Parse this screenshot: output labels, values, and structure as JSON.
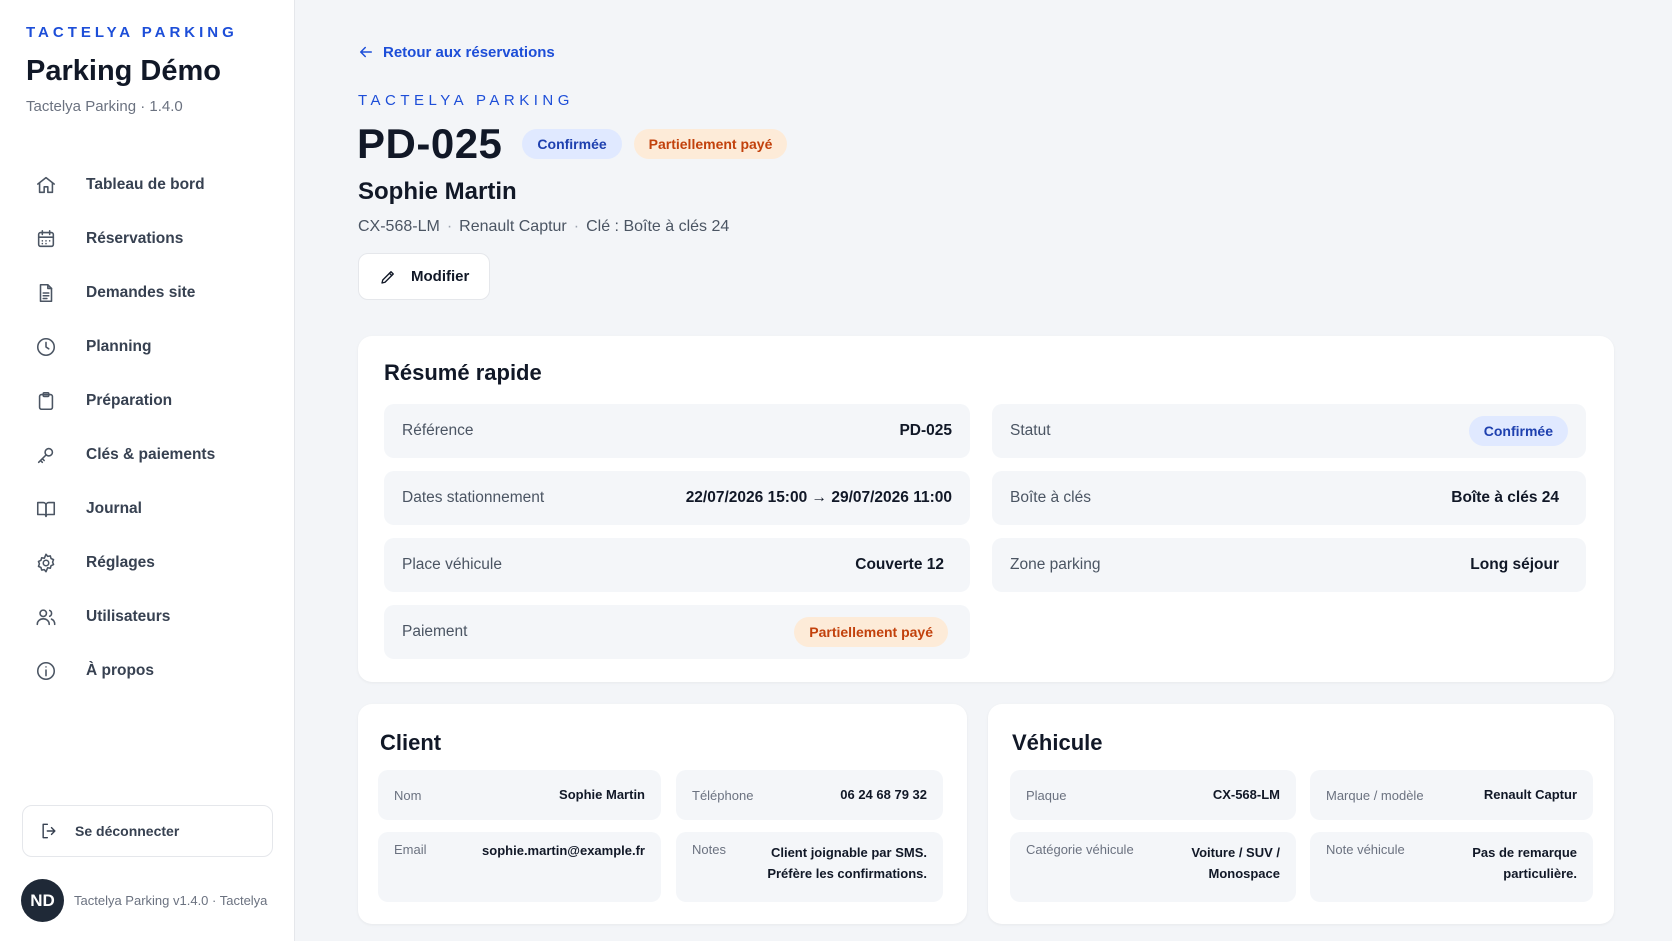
{
  "sidebar": {
    "eyebrow": "TACTELYA PARKING",
    "title": "Parking Démo",
    "subtitle": "Tactelya Parking · 1.4.0",
    "items": [
      {
        "label": "Tableau de bord",
        "icon": "home-icon"
      },
      {
        "label": "Réservations",
        "icon": "calendar-icon"
      },
      {
        "label": "Demandes site",
        "icon": "document-icon"
      },
      {
        "label": "Planning",
        "icon": "clock-icon"
      },
      {
        "label": "Préparation",
        "icon": "clipboard-icon"
      },
      {
        "label": "Clés & paiements",
        "icon": "key-icon"
      },
      {
        "label": "Journal",
        "icon": "book-icon"
      },
      {
        "label": "Réglages",
        "icon": "gear-icon"
      },
      {
        "label": "Utilisateurs",
        "icon": "users-icon"
      },
      {
        "label": "À propos",
        "icon": "info-icon"
      }
    ],
    "logout_label": "Se déconnecter",
    "avatar_initials": "ND",
    "footer_text": "Tactelya Parking v1.4.0 · Tactelya"
  },
  "header": {
    "back_label": "Retour aux réservations",
    "eyebrow": "TACTELYA PARKING",
    "reference": "PD-025",
    "status_badge": "Confirmée",
    "payment_badge": "Partiellement payé",
    "client_name": "Sophie Martin",
    "plate": "CX-568-LM",
    "model": "Renault Captur",
    "key_info": "Clé : Boîte à clés 24",
    "edit_label": "Modifier"
  },
  "summary": {
    "title": "Résumé rapide",
    "reference_label": "Référence",
    "reference_value": "PD-025",
    "status_label": "Statut",
    "status_value": "Confirmée",
    "dates_label": "Dates stationnement",
    "dates_value": "22/07/2026 15:00 → 29/07/2026 11:00",
    "keybox_label": "Boîte à clés",
    "keybox_value": "Boîte à clés 24",
    "place_label": "Place véhicule",
    "place_value": "Couverte 12",
    "zone_label": "Zone parking",
    "zone_value": "Long séjour",
    "payment_label": "Paiement",
    "payment_value": "Partiellement payé"
  },
  "client": {
    "title": "Client",
    "name_label": "Nom",
    "name_value": "Sophie Martin",
    "phone_label": "Téléphone",
    "phone_value": "06 24 68 79 32",
    "email_label": "Email",
    "email_value": "sophie.martin@example.fr",
    "notes_label": "Notes",
    "notes_line1": "Client joignable par SMS.",
    "notes_line2": "Préfère les confirmations."
  },
  "vehicle": {
    "title": "Véhicule",
    "plate_label": "Plaque",
    "plate_value": "CX-568-LM",
    "model_label": "Marque / modèle",
    "model_value": "Renault Captur",
    "category_label": "Catégorie véhicule",
    "category_line1": "Voiture / SUV /",
    "category_line2": "Monospace",
    "note_label": "Note véhicule",
    "note_line1": "Pas de remarque",
    "note_line2": "particulière."
  },
  "colors": {
    "accent": "#1d4ed8",
    "badge_blue_bg": "#e0e9ff",
    "badge_orange_bg": "#fdebd8",
    "badge_orange_text": "#c2410c"
  }
}
